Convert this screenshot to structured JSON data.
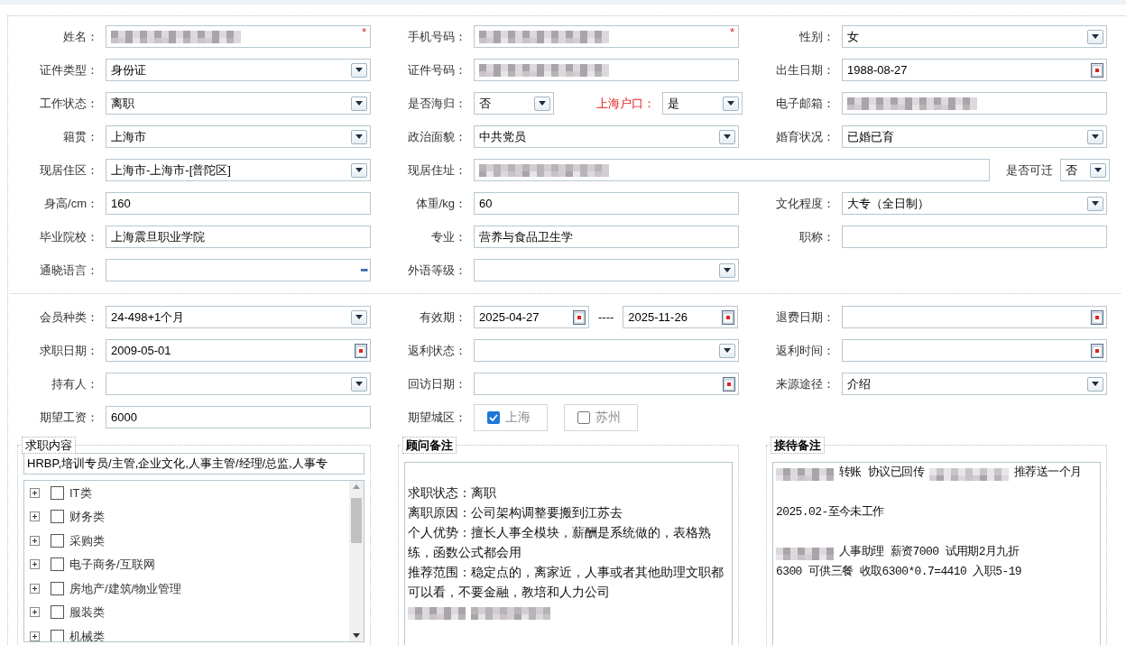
{
  "profile_rows": [
    [
      {
        "kind": "text",
        "label": "姓名：",
        "redacted": true,
        "marker": "*"
      },
      {
        "kind": "text",
        "label": "手机号码：",
        "redacted": true,
        "marker": "*"
      },
      {
        "kind": "select",
        "label": "性别：",
        "value": "女"
      }
    ],
    [
      {
        "kind": "select",
        "label": "证件类型：",
        "value": "身份证"
      },
      {
        "kind": "text",
        "label": "证件号码：",
        "redacted": true
      },
      {
        "kind": "date",
        "label": "出生日期：",
        "value": "1988-08-27"
      }
    ],
    [
      {
        "kind": "select",
        "label": "工作状态：",
        "value": "离职"
      },
      {
        "kind": "select",
        "label": "是否海归：",
        "value": "否",
        "extra": {
          "kind": "select",
          "label": "上海户口：",
          "value": "是",
          "emphasis": true
        }
      },
      {
        "kind": "text",
        "label": "电子邮箱：",
        "redacted": true
      }
    ],
    [
      {
        "kind": "select",
        "label": "籍贯：",
        "value": "上海市"
      },
      {
        "kind": "select",
        "label": "政治面貌：",
        "value": "中共党员"
      },
      {
        "kind": "select",
        "label": "婚育状况：",
        "value": "已婚已育"
      }
    ],
    [
      {
        "kind": "select",
        "label": "现居住区：",
        "value": "上海市-上海市-[普陀区]"
      },
      {
        "kind": "text",
        "label": "现居住址：",
        "redacted": true,
        "extra": {
          "kind": "select",
          "label": "是否可迁",
          "value": "否"
        }
      }
    ],
    [
      {
        "kind": "text",
        "label": "身高/cm：",
        "value": "160"
      },
      {
        "kind": "text",
        "label": "体重/kg：",
        "value": "60"
      },
      {
        "kind": "select",
        "label": "文化程度：",
        "value": "大专（全日制）"
      }
    ],
    [
      {
        "kind": "text",
        "label": "毕业院校：",
        "value": "上海震旦职业学院"
      },
      {
        "kind": "text",
        "label": "专业：",
        "value": "营养与食品卫生学"
      },
      {
        "kind": "text",
        "label": "职称："
      }
    ],
    [
      {
        "kind": "lookup",
        "label": "通晓语言：",
        "button": "•••"
      },
      {
        "kind": "select",
        "label": "外语等级："
      }
    ]
  ],
  "member_rows": [
    [
      {
        "kind": "select",
        "label": "会员种类：",
        "value": "24-498+1个月"
      },
      {
        "kind": "date",
        "label": "有效期：",
        "value": "2025-04-27",
        "range_separator": "----",
        "range_end": "2025-11-26"
      },
      {
        "kind": "date",
        "label": "退费日期："
      }
    ],
    [
      {
        "kind": "date",
        "label": "求职日期：",
        "value": "2009-05-01"
      },
      {
        "kind": "select",
        "label": "返利状态："
      },
      {
        "kind": "date",
        "label": "返利时间："
      }
    ],
    [
      {
        "kind": "select",
        "label": "持有人："
      },
      {
        "kind": "date",
        "label": "回访日期："
      },
      {
        "kind": "select",
        "label": "来源途径：",
        "value": "介绍"
      }
    ],
    [
      {
        "kind": "text",
        "label": "期望工资：",
        "value": "6000"
      },
      {
        "kind": "choices",
        "label": "期望城区：",
        "options": [
          {
            "label": "上海",
            "checked": true
          },
          {
            "label": "苏州",
            "checked": false
          }
        ]
      }
    ]
  ],
  "job_content": {
    "legend": "求职内容",
    "bold": false,
    "value": "HRBP,培训专员/主管,企业文化,人事主管/经理/总监,人事专",
    "categories": [
      {
        "label": "IT类",
        "checked": false,
        "expanded": false
      },
      {
        "label": "财务类",
        "checked": false,
        "expanded": false
      },
      {
        "label": "采购类",
        "checked": false,
        "expanded": false
      },
      {
        "label": "电子商务/互联网",
        "checked": false,
        "expanded": false
      },
      {
        "label": "房地产/建筑/物业管理",
        "checked": false,
        "expanded": false
      },
      {
        "label": "服装类",
        "checked": false,
        "expanded": false
      },
      {
        "label": "机械类",
        "checked": false,
        "expanded": false
      }
    ]
  },
  "notes": [
    {
      "legend": "顾问备注",
      "bold": true,
      "lines": [
        {
          "gap_before": true,
          "parts": [
            "求职状态：离职"
          ]
        },
        {
          "gap_before": false,
          "parts": [
            "离职原因：公司架构调整要搬到江苏去"
          ]
        },
        {
          "gap_before": false,
          "parts": [
            "个人优势：擅长人事全模块，薪酬是系统做的，表格熟"
          ]
        },
        {
          "gap_before": false,
          "parts": [
            "练，函数公式都会用"
          ]
        },
        {
          "gap_before": false,
          "parts": [
            "推荐范围：稳定点的，离家近，人事或者其他助理文职都"
          ]
        },
        {
          "gap_before": false,
          "parts": [
            "可以看，不要金融，教培和人力公司"
          ]
        },
        {
          "gap_before": false,
          "parts": [
            {
              "kind": "redacted"
            },
            {
              "kind": "redacted"
            }
          ]
        }
      ]
    },
    {
      "legend": "接待备注",
      "bold": true,
      "lines": [
        {
          "gap_before": false,
          "parts": [
            {
              "kind": "redacted"
            },
            "转账  协议已回传",
            {
              "kind": "redacted"
            },
            "推荐送一个月"
          ]
        },
        {
          "gap_before": true,
          "parts": [
            "2025.02-至今未工作"
          ]
        },
        {
          "gap_before": true,
          "parts": [
            {
              "kind": "redacted"
            },
            "人事助理  薪资7000 试用期2月九折"
          ]
        },
        {
          "gap_before": false,
          "parts": [
            "6300 可供三餐 收取6300*0.7=4410 入职5-19"
          ]
        }
      ]
    }
  ]
}
